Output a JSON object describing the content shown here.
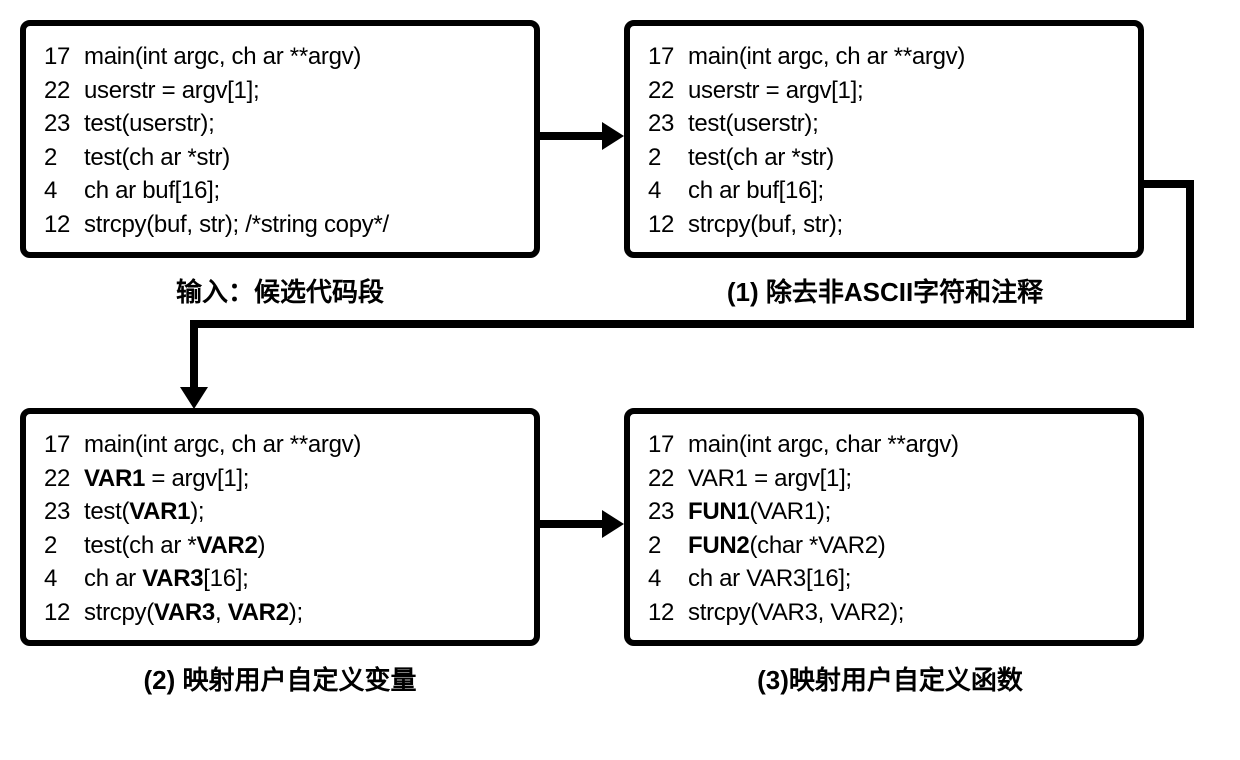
{
  "boxes": {
    "input": {
      "lines": [
        {
          "num": "17",
          "code": "main(int argc, ch ar **argv)"
        },
        {
          "num": "22",
          "code": "userstr = argv[1];"
        },
        {
          "num": "23",
          "code": "test(userstr);"
        },
        {
          "num": "2",
          "code": "test(ch ar *str)"
        },
        {
          "num": "4",
          "code": "ch ar buf[16];"
        },
        {
          "num": "12",
          "code": "strcpy(buf, str); /*string copy*/"
        }
      ],
      "caption": "输入：候选代码段"
    },
    "step1": {
      "lines": [
        {
          "num": "17",
          "code": "main(int argc, ch ar **argv)"
        },
        {
          "num": "22",
          "code": "userstr = argv[1];"
        },
        {
          "num": "23",
          "code": "test(userstr);"
        },
        {
          "num": "2",
          "code": "test(ch ar *str)"
        },
        {
          "num": "4",
          "code": "ch ar buf[16];"
        },
        {
          "num": "12",
          "code": "strcpy(buf, str);"
        }
      ],
      "caption": "(1) 除去非ASCII字符和注释"
    },
    "step2": {
      "lines": [
        {
          "num": "17",
          "code": "main(int argc, ch ar **argv)"
        },
        {
          "num": "22",
          "code_html": "<span class='b'>VAR1</span> = argv[1];"
        },
        {
          "num": "23",
          "code_html": "test(<span class='b'>VAR1</span>);"
        },
        {
          "num": "2",
          "code_html": "test(ch ar *<span class='b'>VAR2</span>)"
        },
        {
          "num": "4",
          "code_html": "ch ar <span class='b'>VAR3</span>[16];"
        },
        {
          "num": "12",
          "code_html": "strcpy(<span class='b'>VAR3</span>, <span class='b'>VAR2</span>);"
        }
      ],
      "caption": "(2) 映射用户自定义变量"
    },
    "step3": {
      "lines": [
        {
          "num": "17",
          "code": "main(int argc, char **argv)"
        },
        {
          "num": "22",
          "code": "VAR1 = argv[1];"
        },
        {
          "num": "23",
          "code_html": "<span class='b'>FUN1</span>(VAR1);"
        },
        {
          "num": "2",
          "code_html": "<span class='b'>FUN2</span>(char *VAR2)"
        },
        {
          "num": "4",
          "code": "ch ar VAR3[16];"
        },
        {
          "num": "12",
          "code": "strcpy(VAR3, VAR2);"
        }
      ],
      "caption": "(3)映射用户自定义函数"
    }
  }
}
